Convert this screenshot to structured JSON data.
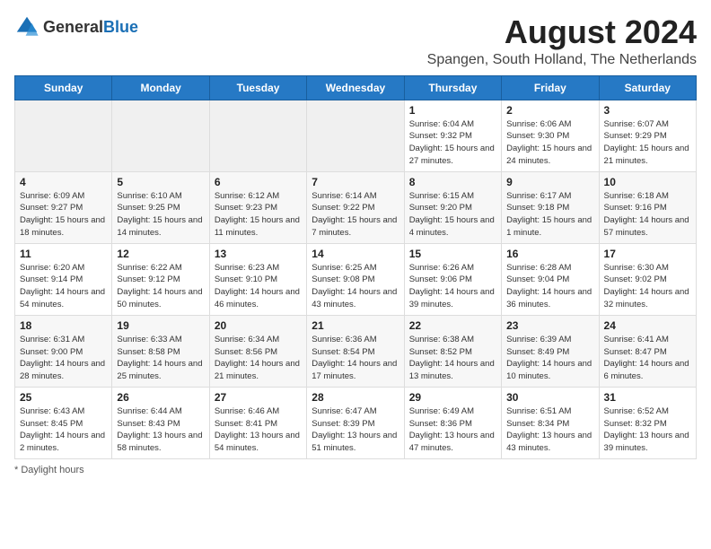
{
  "header": {
    "logo_general": "General",
    "logo_blue": "Blue",
    "month_year": "August 2024",
    "location": "Spangen, South Holland, The Netherlands"
  },
  "weekdays": [
    "Sunday",
    "Monday",
    "Tuesday",
    "Wednesday",
    "Thursday",
    "Friday",
    "Saturday"
  ],
  "weeks": [
    [
      {
        "day": "",
        "info": ""
      },
      {
        "day": "",
        "info": ""
      },
      {
        "day": "",
        "info": ""
      },
      {
        "day": "",
        "info": ""
      },
      {
        "day": "1",
        "info": "Sunrise: 6:04 AM\nSunset: 9:32 PM\nDaylight: 15 hours and 27 minutes."
      },
      {
        "day": "2",
        "info": "Sunrise: 6:06 AM\nSunset: 9:30 PM\nDaylight: 15 hours and 24 minutes."
      },
      {
        "day": "3",
        "info": "Sunrise: 6:07 AM\nSunset: 9:29 PM\nDaylight: 15 hours and 21 minutes."
      }
    ],
    [
      {
        "day": "4",
        "info": "Sunrise: 6:09 AM\nSunset: 9:27 PM\nDaylight: 15 hours and 18 minutes."
      },
      {
        "day": "5",
        "info": "Sunrise: 6:10 AM\nSunset: 9:25 PM\nDaylight: 15 hours and 14 minutes."
      },
      {
        "day": "6",
        "info": "Sunrise: 6:12 AM\nSunset: 9:23 PM\nDaylight: 15 hours and 11 minutes."
      },
      {
        "day": "7",
        "info": "Sunrise: 6:14 AM\nSunset: 9:22 PM\nDaylight: 15 hours and 7 minutes."
      },
      {
        "day": "8",
        "info": "Sunrise: 6:15 AM\nSunset: 9:20 PM\nDaylight: 15 hours and 4 minutes."
      },
      {
        "day": "9",
        "info": "Sunrise: 6:17 AM\nSunset: 9:18 PM\nDaylight: 15 hours and 1 minute."
      },
      {
        "day": "10",
        "info": "Sunrise: 6:18 AM\nSunset: 9:16 PM\nDaylight: 14 hours and 57 minutes."
      }
    ],
    [
      {
        "day": "11",
        "info": "Sunrise: 6:20 AM\nSunset: 9:14 PM\nDaylight: 14 hours and 54 minutes."
      },
      {
        "day": "12",
        "info": "Sunrise: 6:22 AM\nSunset: 9:12 PM\nDaylight: 14 hours and 50 minutes."
      },
      {
        "day": "13",
        "info": "Sunrise: 6:23 AM\nSunset: 9:10 PM\nDaylight: 14 hours and 46 minutes."
      },
      {
        "day": "14",
        "info": "Sunrise: 6:25 AM\nSunset: 9:08 PM\nDaylight: 14 hours and 43 minutes."
      },
      {
        "day": "15",
        "info": "Sunrise: 6:26 AM\nSunset: 9:06 PM\nDaylight: 14 hours and 39 minutes."
      },
      {
        "day": "16",
        "info": "Sunrise: 6:28 AM\nSunset: 9:04 PM\nDaylight: 14 hours and 36 minutes."
      },
      {
        "day": "17",
        "info": "Sunrise: 6:30 AM\nSunset: 9:02 PM\nDaylight: 14 hours and 32 minutes."
      }
    ],
    [
      {
        "day": "18",
        "info": "Sunrise: 6:31 AM\nSunset: 9:00 PM\nDaylight: 14 hours and 28 minutes."
      },
      {
        "day": "19",
        "info": "Sunrise: 6:33 AM\nSunset: 8:58 PM\nDaylight: 14 hours and 25 minutes."
      },
      {
        "day": "20",
        "info": "Sunrise: 6:34 AM\nSunset: 8:56 PM\nDaylight: 14 hours and 21 minutes."
      },
      {
        "day": "21",
        "info": "Sunrise: 6:36 AM\nSunset: 8:54 PM\nDaylight: 14 hours and 17 minutes."
      },
      {
        "day": "22",
        "info": "Sunrise: 6:38 AM\nSunset: 8:52 PM\nDaylight: 14 hours and 13 minutes."
      },
      {
        "day": "23",
        "info": "Sunrise: 6:39 AM\nSunset: 8:49 PM\nDaylight: 14 hours and 10 minutes."
      },
      {
        "day": "24",
        "info": "Sunrise: 6:41 AM\nSunset: 8:47 PM\nDaylight: 14 hours and 6 minutes."
      }
    ],
    [
      {
        "day": "25",
        "info": "Sunrise: 6:43 AM\nSunset: 8:45 PM\nDaylight: 14 hours and 2 minutes."
      },
      {
        "day": "26",
        "info": "Sunrise: 6:44 AM\nSunset: 8:43 PM\nDaylight: 13 hours and 58 minutes."
      },
      {
        "day": "27",
        "info": "Sunrise: 6:46 AM\nSunset: 8:41 PM\nDaylight: 13 hours and 54 minutes."
      },
      {
        "day": "28",
        "info": "Sunrise: 6:47 AM\nSunset: 8:39 PM\nDaylight: 13 hours and 51 minutes."
      },
      {
        "day": "29",
        "info": "Sunrise: 6:49 AM\nSunset: 8:36 PM\nDaylight: 13 hours and 47 minutes."
      },
      {
        "day": "30",
        "info": "Sunrise: 6:51 AM\nSunset: 8:34 PM\nDaylight: 13 hours and 43 minutes."
      },
      {
        "day": "31",
        "info": "Sunrise: 6:52 AM\nSunset: 8:32 PM\nDaylight: 13 hours and 39 minutes."
      }
    ]
  ],
  "footer": {
    "note": "Daylight hours"
  }
}
